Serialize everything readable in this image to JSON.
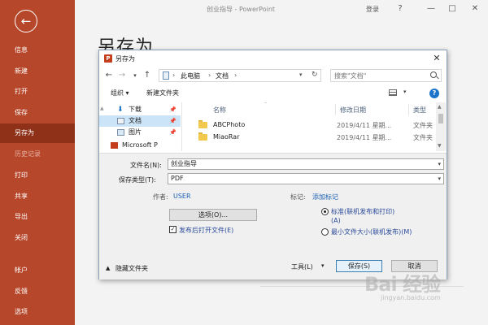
{
  "sidebar": {
    "back_icon": "back-arrow-icon",
    "items": [
      {
        "label": "信息"
      },
      {
        "label": "新建"
      },
      {
        "label": "打开"
      },
      {
        "label": "保存"
      },
      {
        "label": "另存为"
      },
      {
        "label": "历史记录"
      },
      {
        "label": "打印"
      },
      {
        "label": "共享"
      },
      {
        "label": "导出"
      },
      {
        "label": "关闭"
      },
      {
        "label": "帐户"
      },
      {
        "label": "反馈"
      },
      {
        "label": "选项"
      }
    ]
  },
  "titlebar": {
    "title": "创业指导 - PowerPoint",
    "login": "登录",
    "help": "?",
    "minimize": "—",
    "restore": "□",
    "close": "✕"
  },
  "page_title": "另存为",
  "dialog": {
    "title": "另存为",
    "close": "✕",
    "address": {
      "crumbs": [
        "此电脑",
        "文档"
      ]
    },
    "search_placeholder": "搜索\"文档\"",
    "toolbar": {
      "organize": "组织 ▾",
      "new_folder": "新建文件夹"
    },
    "nav_pane": [
      {
        "label": "下载",
        "icon": "download-icon",
        "pinned": true
      },
      {
        "label": "文档",
        "icon": "document-icon",
        "pinned": true,
        "selected": true
      },
      {
        "label": "图片",
        "icon": "picture-icon",
        "pinned": true
      },
      {
        "label": "Microsoft P",
        "icon": "powerpoint-icon",
        "pinned": false
      }
    ],
    "columns": {
      "name": "名称",
      "date": "修改日期",
      "type": "类型"
    },
    "files": [
      {
        "name": "ABCPhoto",
        "date": "2019/4/11 星期...",
        "type": "文件夹"
      },
      {
        "name": "MiaoRar",
        "date": "2019/4/11 星期...",
        "type": "文件夹"
      }
    ],
    "form": {
      "filename_label": "文件名(N):",
      "filename_value": "创业指导",
      "filetype_label": "保存类型(T):",
      "filetype_value": "PDF",
      "author_label": "作者:",
      "author_value": "USER",
      "tags_label": "标记:",
      "tags_link": "添加标记",
      "options_button": "选项(O)...",
      "open_after_publish": "发布后打开文件(E)",
      "radio_standard": "标准(联机发布和打印)\n(A)",
      "radio_minimum": "最小文件大小(联机发布)(M)",
      "hide_folders": "隐藏文件夹",
      "tools": "工具(L)",
      "save": "保存(S)",
      "cancel": "取消"
    }
  },
  "watermark": {
    "text": "Bai 经验",
    "sub": "jingyan.baidu.com"
  }
}
